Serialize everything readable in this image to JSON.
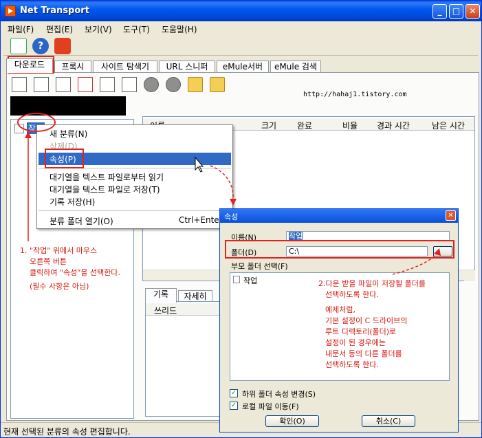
{
  "window": {
    "title": "Net Transport"
  },
  "menu": [
    "파일(F)",
    "편집(E)",
    "보기(V)",
    "도구(T)",
    "도움말(H)"
  ],
  "tabs": [
    "다운로드",
    "프록시",
    "사이트 탐색기",
    "URL 스니퍼",
    "eMule서버",
    "eMule 검색"
  ],
  "url_text": "http://hahaj1.tistory.com",
  "tree": {
    "root_label": "작업"
  },
  "list_columns": [
    "이름",
    "크기",
    "완료",
    "비율",
    "경과 시간",
    "남은 시간"
  ],
  "log_tabs": [
    "기록",
    "자세히"
  ],
  "log_column": "쓰리드",
  "context_menu": {
    "items": [
      {
        "label": "새 분류(N)",
        "disabled": false
      },
      {
        "label": "삭제(D)",
        "disabled": true
      },
      {
        "label": "속성(P)",
        "disabled": false
      },
      {
        "label": "대기열을 텍스트 파일로부터 읽기",
        "disabled": false
      },
      {
        "label": "대기열을 텍스트 파일로 저장(T)",
        "disabled": false
      },
      {
        "label": "기록 저장(H)",
        "disabled": false
      },
      {
        "label": "분류 폴더 열기(O)",
        "disabled": false,
        "shortcut": "Ctrl+Enter"
      }
    ]
  },
  "dialog": {
    "title": "속성",
    "name_label": "이름(N)",
    "name_value": "작업",
    "folder_label": "폴더(D)",
    "folder_value": "C:\\",
    "parent_label": "부모 폴더 선택(F)",
    "tree_item": "작업",
    "check1": "하위 폴더 속성 변경(S)",
    "check2": "로컬 파일 이동(F)",
    "ok": "확인(O)",
    "cancel": "취소(C)"
  },
  "status_text": "현재 선택된 분류의 속성 편집합니다.",
  "annotations": {
    "note1": [
      "1. \"작업\" 위에서 마우스",
      "오른쪽 버튼",
      "클릭하여 \"속성\"을 선택한다.",
      "(필수 사항은 아님)"
    ],
    "note2": [
      "2.다운 받을 파일이 저장될 폴더를",
      "선택하도록 한다.",
      "예제처럼,",
      "기본 설정이 C 드라이브의",
      "루트 디렉토리(폴더)로",
      "설정이 된 경우에는",
      "내문서 등의 다른 폴더를",
      "선택하도록 한다."
    ]
  },
  "colors": {
    "annotation_red": "#e4211a",
    "selection_blue": "#316ac5",
    "titlebar_blue": "#0058ee"
  }
}
